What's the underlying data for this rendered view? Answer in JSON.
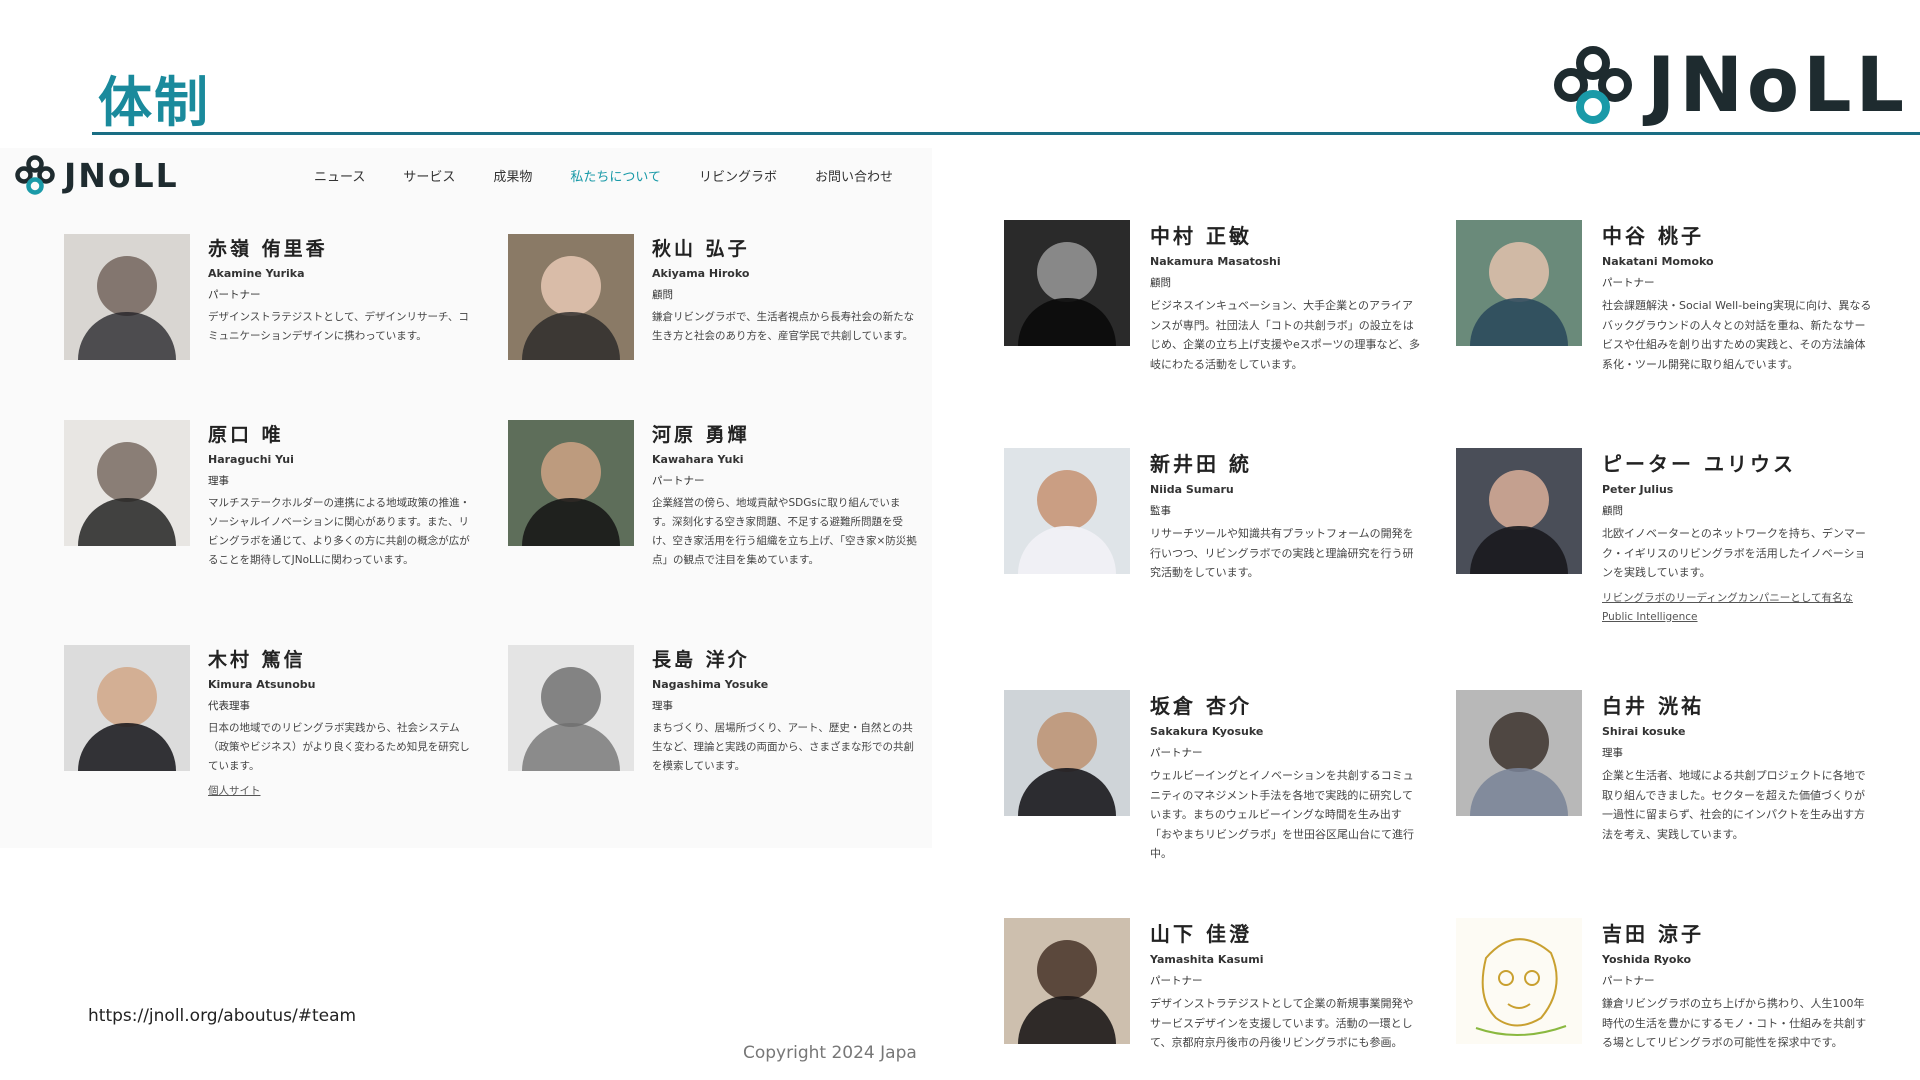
{
  "slide": {
    "title": "体制",
    "brand_word": "JNoLL",
    "url": "https://jnoll.org/aboutus/#team",
    "copyright": "Copyright 2024  Japa"
  },
  "colors": {
    "accent": "#1a8a9c",
    "rule": "#1a6e84",
    "nav_active": "#1a9aa8",
    "logo_dark": "#1e2b2f"
  },
  "site": {
    "logo_word": "JNoLL",
    "nav": [
      {
        "label": "ニュース",
        "active": false
      },
      {
        "label": "サービス",
        "active": false
      },
      {
        "label": "成果物",
        "active": false
      },
      {
        "label": "私たちについて",
        "active": true
      },
      {
        "label": "リビングラボ",
        "active": false
      },
      {
        "label": "お問い合わせ",
        "active": false
      }
    ]
  },
  "left_members": [
    {
      "name": "赤嶺 侑里香",
      "roman": "Akamine Yurika",
      "role": "パートナー",
      "desc": "デザインストラテジストとして、デザインリサーチ、コミュニケーションデザインに携わっています。"
    },
    {
      "name": "秋山 弘子",
      "roman": "Akiyama Hiroko",
      "role": "顧問",
      "desc": "鎌倉リビングラボで、生活者視点から長寿社会の新たな生き方と社会のあり方を、産官学民で共創しています。"
    },
    {
      "name": "原口 唯",
      "roman": "Haraguchi Yui",
      "role": "理事",
      "desc": "マルチステークホルダーの連携による地域政策の推進・ソーシャルイノベーションに関心があります。また、リビングラボを通じて、より多くの方に共創の概念が広がることを期待してJNoLLに関わっています。"
    },
    {
      "name": "河原 勇輝",
      "roman": "Kawahara Yuki",
      "role": "パートナー",
      "desc": "企業経営の傍ら、地域貢献やSDGsに取り組んでいます。深刻化する空き家問題、不足する避難所問題を受け、空き家活用を行う組織を立ち上げ、「空き家×防災拠点」の観点で注目を集めています。"
    },
    {
      "name": "木村 篤信",
      "roman": "Kimura Atsunobu",
      "role": "代表理事",
      "desc": "日本の地域でのリビングラボ実践から、社会システム（政策やビジネス）がより良く変わるため知見を研究しています。",
      "link": "個人サイト"
    },
    {
      "name": "長島 洋介",
      "roman": "Nagashima Yosuke",
      "role": "理事",
      "desc": "まちづくり、居場所づくり、アート、歴史・自然との共生など、理論と実践の両面から、さまざまな形での共創を模索しています。"
    }
  ],
  "right_members": [
    {
      "name": "中村 正敏",
      "roman": "Nakamura Masatoshi",
      "role": "顧問",
      "desc": "ビジネスインキュベーション、大手企業とのアライアンスが専門。社団法人「コトの共創ラボ」の設立をはじめ、企業の立ち上げ支援やeスポーツの理事など、多岐にわたる活動をしています。"
    },
    {
      "name": "中谷 桃子",
      "roman": "Nakatani Momoko",
      "role": "パートナー",
      "desc": "社会課題解決・Social Well-being実現に向け、異なるバックグラウンドの人々との対話を重ね、新たなサービスや仕組みを創り出すための実践と、その方法論体系化・ツール開発に取り組んでいます。"
    },
    {
      "name": "新井田 統",
      "roman": "Niida Sumaru",
      "role": "監事",
      "desc": "リサーチツールや知識共有プラットフォームの開発を行いつつ、リビングラボでの実践と理論研究を行う研究活動をしています。"
    },
    {
      "name": "ピーター ユリウス",
      "roman": "Peter Julius",
      "role": "顧問",
      "desc": "北欧イノベーターとのネットワークを持ち、デンマーク・イギリスのリビングラボを活用したイノベーションを実践しています。",
      "link": "リビングラボのリーディングカンパニーとして有名な Public Intelligence"
    },
    {
      "name": "坂倉 杏介",
      "roman": "Sakakura Kyosuke",
      "role": "パートナー",
      "desc": "ウェルビーイングとイノベーションを共創するコミュニティのマネジメント手法を各地で実践的に研究しています。まちのウェルビーイングな時間を生み出す「おやまちリビングラボ」を世田谷区尾山台にて進行中。"
    },
    {
      "name": "白井 洸祐",
      "roman": "Shirai kosuke",
      "role": "理事",
      "desc": "企業と生活者、地域による共創プロジェクトに各地で取り組んできました。セクターを超えた価値づくりが一過性に留まらず、社会的にインパクトを生み出す方法を考え、実践しています。"
    },
    {
      "name": "山下 佳澄",
      "roman": "Yamashita Kasumi",
      "role": "パートナー",
      "desc": "デザインストラテジストとして企業の新規事業開発やサービスデザインを支援しています。活動の一環として、京都府京丹後市の丹後リビングラボにも参画。"
    },
    {
      "name": "吉田 涼子",
      "roman": "Yoshida Ryoko",
      "role": "パートナー",
      "desc": "鎌倉リビングラボの立ち上げから携わり、人生100年時代の生活を豊かにするモノ・コト・仕組みを共創する場としてリビングラボの可能性を探求中です。"
    }
  ]
}
